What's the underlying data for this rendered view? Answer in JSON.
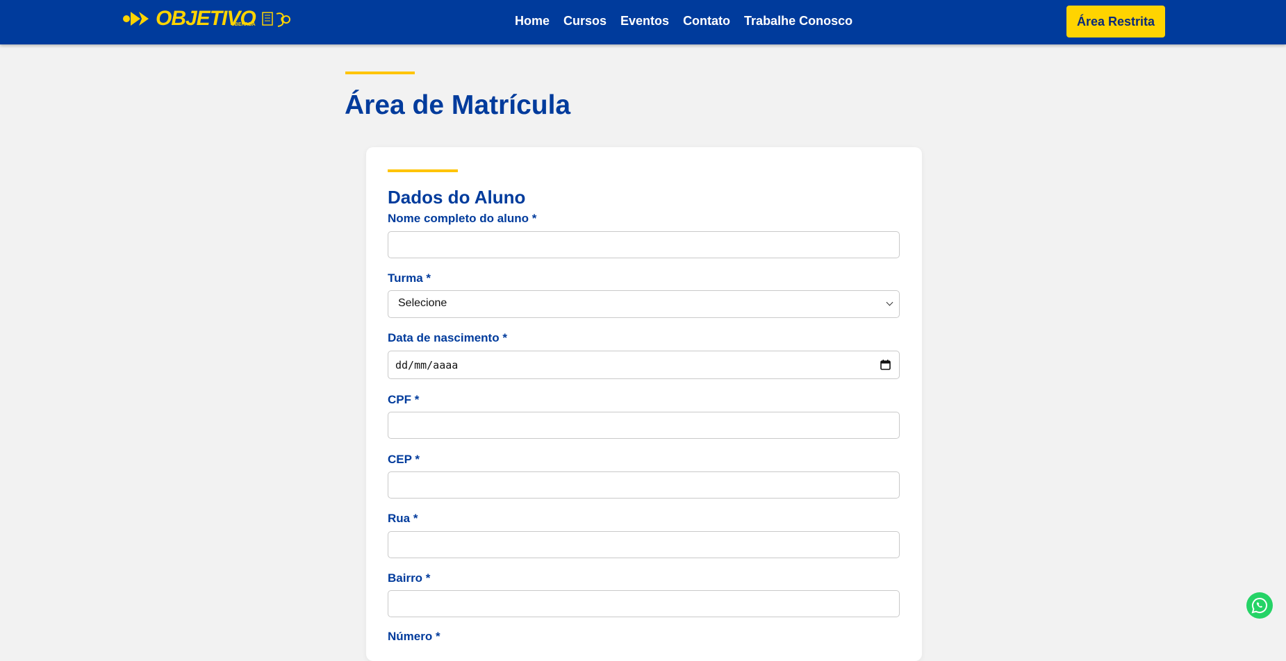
{
  "header": {
    "logo_text": "OBJETIVO",
    "logo_subtext": "UBERABA",
    "nav": [
      "Home",
      "Cursos",
      "Eventos",
      "Contato",
      "Trabalhe Conosco"
    ],
    "restrita_label": "Área Restrita"
  },
  "page": {
    "title": "Área de Matrícula"
  },
  "form": {
    "section_title": "Dados do Aluno",
    "fields": [
      {
        "label": "Nome completo do aluno *",
        "type": "text",
        "value": ""
      },
      {
        "label": "Turma *",
        "type": "select",
        "value": "Selecione"
      },
      {
        "label": "Data de nascimento *",
        "type": "date",
        "value": "dd/mm/aaaa"
      },
      {
        "label": "CPF *",
        "type": "text",
        "value": ""
      },
      {
        "label": "CEP *",
        "type": "text",
        "value": ""
      },
      {
        "label": "Rua *",
        "type": "text",
        "value": ""
      },
      {
        "label": "Bairro *",
        "type": "text",
        "value": ""
      },
      {
        "label": "Número *",
        "type": "text",
        "value": ""
      }
    ]
  },
  "icons": {
    "logo": "objetivo-logo-icon",
    "badge": "anniversary-badge-icon",
    "calendar": "calendar-icon",
    "chevron": "chevron-down-icon",
    "whatsapp": "whatsapp-icon"
  },
  "colors": {
    "brand_blue": "#003b9c",
    "brand_yellow": "#ffd400",
    "accent_bar": "#ffc400",
    "whatsapp_green": "#25d366"
  }
}
